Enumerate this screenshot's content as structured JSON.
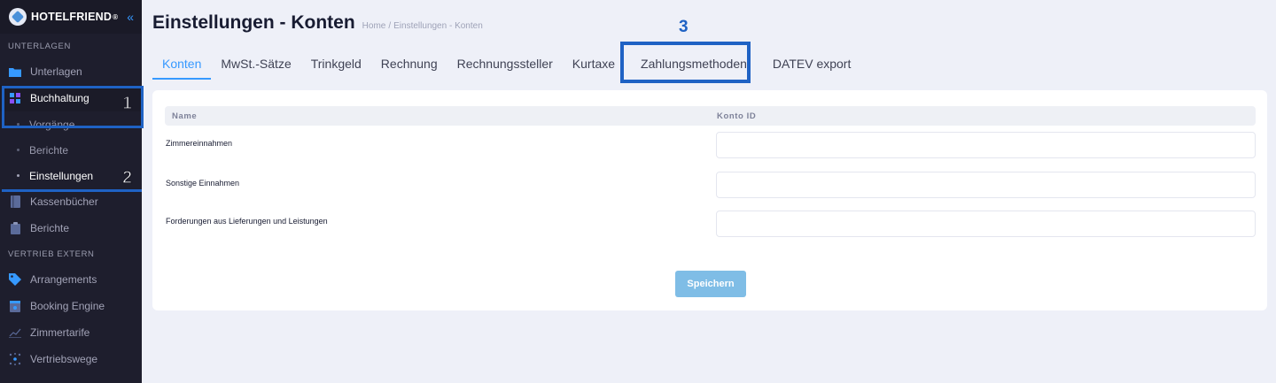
{
  "brand": {
    "name": "HOTELFRIEND",
    "mark": "®",
    "toggle_icon": "chevron-double-left-icon"
  },
  "sidebar": {
    "sections": [
      {
        "title": "UNTERLAGEN",
        "items": [
          {
            "label": "Unterlagen",
            "icon": "folder-icon"
          },
          {
            "label": "Buchhaltung",
            "icon": "grid-icon",
            "active": true,
            "callout": "1",
            "sub": [
              {
                "label": "Vorgänge"
              },
              {
                "label": "Berichte"
              },
              {
                "label": "Einstellungen",
                "active": true,
                "callout": "2"
              }
            ]
          },
          {
            "label": "Kassenbücher",
            "icon": "book-icon"
          },
          {
            "label": "Berichte",
            "icon": "clipboard-icon"
          }
        ]
      },
      {
        "title": "VERTRIEB EXTERN",
        "items": [
          {
            "label": "Arrangements",
            "icon": "tag-icon"
          },
          {
            "label": "Booking Engine",
            "icon": "calendar-icon"
          },
          {
            "label": "Zimmertarife",
            "icon": "chart-icon"
          },
          {
            "label": "Vertriebswege",
            "icon": "network-icon"
          }
        ]
      }
    ]
  },
  "header": {
    "title": "Einstellungen - Konten",
    "breadcrumb": [
      "Home",
      "Einstellungen - Konten"
    ],
    "breadcrumb_sep": "/"
  },
  "tabs": [
    {
      "label": "Konten",
      "active": true
    },
    {
      "label": "MwSt.-Sätze"
    },
    {
      "label": "Trinkgeld"
    },
    {
      "label": "Rechnung"
    },
    {
      "label": "Rechnungssteller"
    },
    {
      "label": "Kurtaxe"
    },
    {
      "label": "Zahlungsmethoden",
      "callout": "3"
    },
    {
      "label": "DATEV export"
    }
  ],
  "table": {
    "columns": [
      "Name",
      "Konto ID"
    ],
    "rows": [
      {
        "label": "Zimmereinnahmen",
        "value": ""
      },
      {
        "label": "Sonstige Einnahmen",
        "value": ""
      },
      {
        "label": "Forderungen aus Lieferungen und Leistungen",
        "value": ""
      }
    ]
  },
  "save_label": "Speichern",
  "colors": {
    "accent": "#3699ff",
    "sidebar_bg": "#1e1e2d",
    "callout": "#1f62c4",
    "button": "#7fbde6"
  }
}
